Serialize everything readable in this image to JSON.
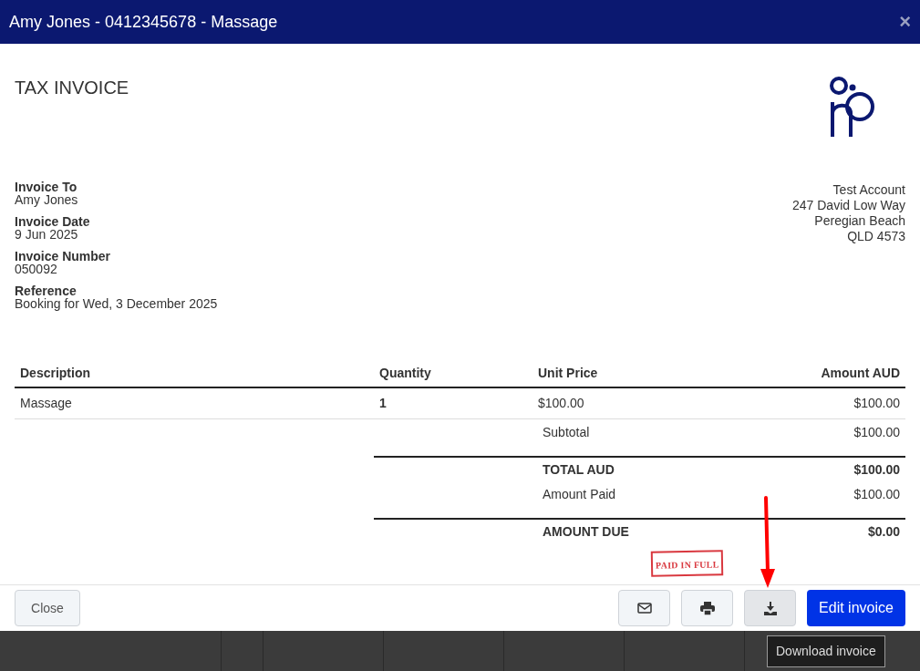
{
  "dialog": {
    "title": "Amy Jones - 0412345678 - Massage",
    "close_icon": "×"
  },
  "invoice": {
    "heading": "TAX INVOICE",
    "details": [
      {
        "label": "Invoice To",
        "value": "Amy Jones"
      },
      {
        "label": "Invoice Date",
        "value": "9 Jun 2025"
      },
      {
        "label": "Invoice Number",
        "value": "050092"
      },
      {
        "label": "Reference",
        "value": "Booking for Wed, 3 December 2025"
      }
    ],
    "from_address": [
      "Test Account",
      "247 David Low Way",
      "Peregian Beach",
      "QLD 4573"
    ],
    "table": {
      "columns": [
        "Description",
        "Quantity",
        "Unit Price",
        "Amount AUD"
      ],
      "rows": [
        [
          "Massage",
          "1",
          "$100.00",
          "$100.00"
        ]
      ]
    },
    "summary": [
      {
        "label": "Subtotal",
        "value": "$100.00",
        "kind": "line"
      },
      {
        "label": "TOTAL AUD",
        "value": "$100.00",
        "kind": "total"
      },
      {
        "label": "Amount Paid",
        "value": "$100.00",
        "kind": "line"
      },
      {
        "label": "AMOUNT DUE",
        "value": "$0.00",
        "kind": "total"
      }
    ],
    "stamp": "PAID IN FULL"
  },
  "footer": {
    "close": "Close",
    "edit": "Edit invoice",
    "tooltip": "Download invoice"
  }
}
